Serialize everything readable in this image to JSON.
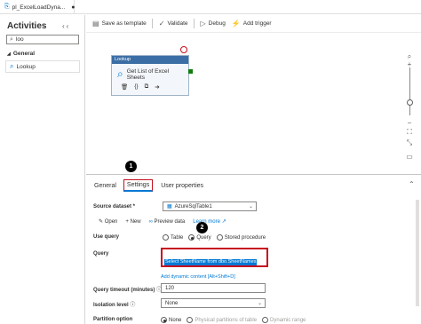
{
  "tab": {
    "label": "pl_ExcelLoadDyna...",
    "dot": "●"
  },
  "activities": {
    "title": "Activities",
    "collapse_icons": "‹‹",
    "search_value": "loo",
    "group": "General",
    "item": "Lookup"
  },
  "toolbar": {
    "save_template": "Save as template",
    "validate": "Validate",
    "debug": "Debug",
    "add_trigger": "Add trigger"
  },
  "node": {
    "header": "Lookup",
    "name": "Get List of Excel Sheets"
  },
  "panel": {
    "tabs": [
      "General",
      "Settings",
      "User properties"
    ],
    "active_tab": "Settings",
    "badge1": "1",
    "badge2": "2",
    "source_dataset_label": "Source dataset *",
    "source_dataset_value": "AzureSqlTable1",
    "open": "Open",
    "new": "New",
    "preview": "Preview data",
    "learn_more": "Learn more",
    "use_query_label": "Use query",
    "use_query_options": [
      "Table",
      "Query",
      "Stored procedure"
    ],
    "use_query_selected": "Query",
    "query_label": "Query",
    "query_text": "Select SheetName from dbo.SheetNames",
    "dynamic_content": "Add dynamic content [Alt+Shift+D]",
    "timeout_label": "Query timeout (minutes)",
    "timeout_value": "120",
    "isolation_label": "Isolation level",
    "isolation_value": "None",
    "partition_label": "Partition option",
    "partition_options": [
      "None",
      "Physical partitions of table",
      "Dynamic range"
    ]
  },
  "colors": {
    "accent": "#0078d4",
    "highlight": "#c50f1f",
    "node_header": "#3b6ea5"
  }
}
